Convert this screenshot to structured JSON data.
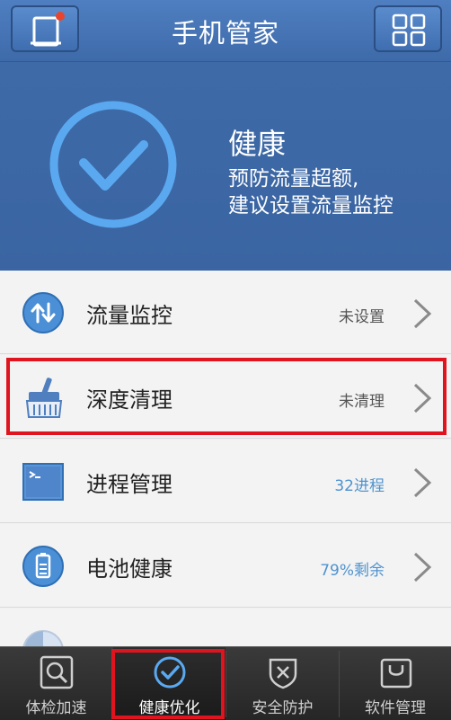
{
  "header": {
    "title": "手机管家",
    "left_icon": "phone-notification-icon",
    "right_icon": "grid-menu-icon"
  },
  "hero": {
    "status_icon": "check-circle-icon",
    "status_title": "健康",
    "message_line1": "预防流量超额,",
    "message_line2": "建议设置流量监控"
  },
  "list": {
    "items": [
      {
        "icon": "data-transfer-icon",
        "label": "流量监控",
        "status": "未设置"
      },
      {
        "icon": "brush-clean-icon",
        "label": "深度清理",
        "status": "未清理"
      },
      {
        "icon": "terminal-process-icon",
        "label": "进程管理",
        "status": "32进程"
      },
      {
        "icon": "battery-icon",
        "label": "电池健康",
        "status": "79%剩余"
      }
    ]
  },
  "nav": {
    "tabs": [
      {
        "icon": "search-check-icon",
        "label": "体检加速"
      },
      {
        "icon": "check-circle-icon",
        "label": "健康优化"
      },
      {
        "icon": "shield-icon",
        "label": "安全防护"
      },
      {
        "icon": "bag-icon",
        "label": "软件管理"
      }
    ],
    "active_tab": "健康优化"
  },
  "colors": {
    "header_blue": "#4a79bb",
    "hero_blue": "#3c67a5",
    "accent_blue": "#4f93cf",
    "highlight_red": "#e0141e"
  }
}
